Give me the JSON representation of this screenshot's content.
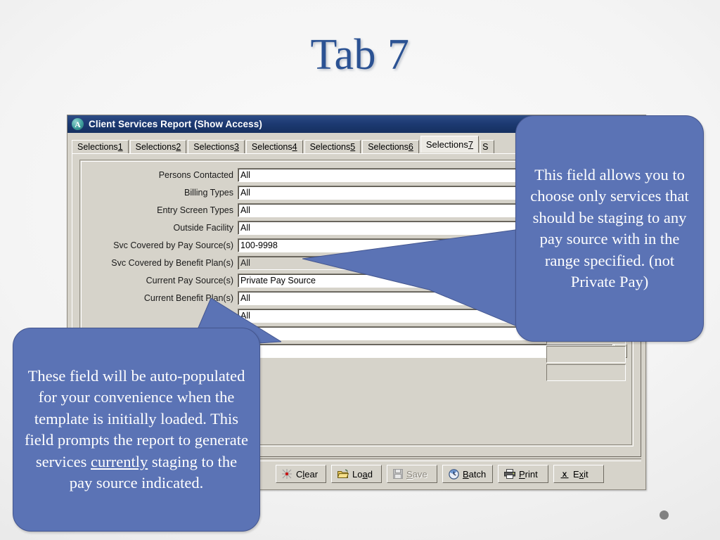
{
  "slide": {
    "title": "Tab 7",
    "title_color": "#2b5293",
    "background_color": "#ededed",
    "decoration_dot_color": "#6e6e6e"
  },
  "window": {
    "title": "Client Services Report (Show Access)",
    "icon": "access-app-icon",
    "icon_letter": "A",
    "titlebar_color": "#1d3a73",
    "chrome_color": "#d6d3ca",
    "tabs": [
      {
        "label": "Selections",
        "mnemonic": "1",
        "active": false
      },
      {
        "label": "Selections",
        "mnemonic": "2",
        "active": false
      },
      {
        "label": "Selections",
        "mnemonic": "3",
        "active": false
      },
      {
        "label": "Selections",
        "mnemonic": "4",
        "active": false
      },
      {
        "label": "Selections",
        "mnemonic": "5",
        "active": false
      },
      {
        "label": "Selections",
        "mnemonic": "6",
        "active": false
      },
      {
        "label": "Selections",
        "mnemonic": "7",
        "active": true
      },
      {
        "label": "S",
        "mnemonic": "",
        "active": false,
        "clipped": true
      }
    ],
    "form": {
      "rows": [
        {
          "label": "Persons Contacted",
          "value": "All",
          "disabled": false,
          "lookup": true
        },
        {
          "label": "Billing Types",
          "value": "All",
          "disabled": false,
          "lookup": true
        },
        {
          "label": "Entry Screen Types",
          "value": "All",
          "disabled": false,
          "lookup": true
        },
        {
          "label": "Outside Facility",
          "value": "All",
          "disabled": false,
          "lookup": true
        },
        {
          "label": "Svc Covered by Pay Source(s)",
          "value": "100-9998",
          "disabled": false,
          "lookup": true
        },
        {
          "label": "Svc Covered by Benefit Plan(s)",
          "value": "All",
          "disabled": true,
          "lookup": true
        },
        {
          "label": "Current Pay Source(s)",
          "value": "Private Pay Source",
          "disabled": false,
          "lookup": true
        },
        {
          "label": "Current Benefit Plan(s)",
          "value": "All",
          "disabled": false,
          "lookup": true
        },
        {
          "label": "",
          "value": "All",
          "disabled": false,
          "lookup": true
        },
        {
          "label": "",
          "value": "",
          "disabled": false,
          "lookup": true
        },
        {
          "label": "",
          "value": "",
          "disabled": false,
          "lookup": true
        }
      ],
      "lookup_icon": "magnifier-icon"
    },
    "buttons": [
      {
        "label": "Clear",
        "mnemonic_index": 1,
        "icon": "clear-icon",
        "disabled": false
      },
      {
        "label": "Load",
        "mnemonic_index": 2,
        "icon": "folder-open-icon",
        "disabled": false
      },
      {
        "label": "Save",
        "mnemonic_index": 0,
        "icon": "floppy-disk-icon",
        "disabled": true
      },
      {
        "label": "Batch",
        "mnemonic_index": 0,
        "icon": "clock-icon",
        "disabled": false
      },
      {
        "label": "Print",
        "mnemonic_index": 0,
        "icon": "printer-icon",
        "disabled": false
      },
      {
        "label": "Exit",
        "mnemonic_index": 1,
        "icon": "close-x-icon",
        "disabled": false
      }
    ]
  },
  "callouts": {
    "color": "#5b73b5",
    "right": {
      "text": "This field allows you to choose only services that should be staging to any pay source with in the range specified. (not Private Pay)"
    },
    "left": {
      "text_part1": "These field will be auto-populated for your convenience when the template is initially loaded. This field prompts the report to generate services ",
      "emphasis": "currently",
      "text_part2": " staging to the pay source indicated."
    }
  }
}
